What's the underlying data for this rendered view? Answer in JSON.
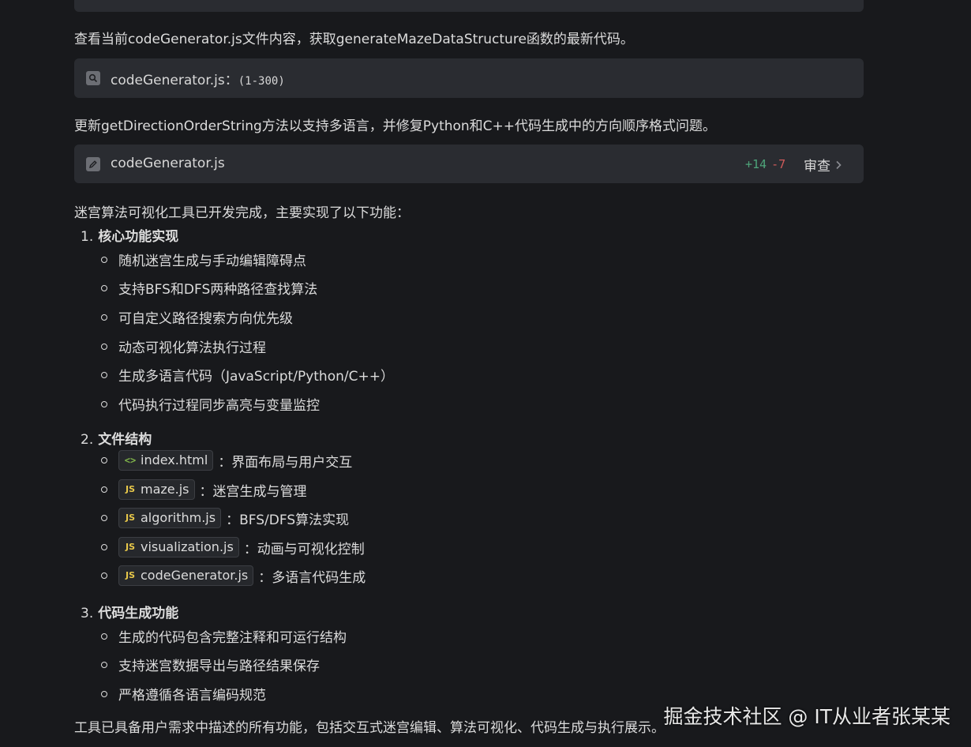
{
  "messages": {
    "view_file_intro": "查看当前codeGenerator.js文件内容，获取generateMazeDataStructure函数的最新代码。",
    "update_intro": "更新getDirectionOrderString方法以支持多语言，并修复Python和C++代码生成中的方向顺序格式问题。",
    "summary_intro": "迷宫算法可视化工具已开发完成，主要实现了以下功能：",
    "closing": "工具已具备用户需求中描述的所有功能，包括交互式迷宫编辑、算法可视化、代码生成与执行展示。"
  },
  "read_card": {
    "icon": "search-icon",
    "filename": "codeGenerator.js",
    "separator": "：",
    "range": "(1-300)"
  },
  "edit_card": {
    "icon": "pencil-icon",
    "filename": "codeGenerator.js",
    "additions": "+14",
    "deletions": "-7",
    "review_label": "审查"
  },
  "sections": [
    {
      "number": "1.",
      "title": "核心功能实现",
      "items": [
        "随机迷宫生成与手动编辑障碍点",
        "支持BFS和DFS两种路径查找算法",
        "可自定义路径搜索方向优先级",
        "动态可视化算法执行过程",
        "生成多语言代码（JavaScript/Python/C++）",
        "代码执行过程同步高亮与变量监控"
      ]
    },
    {
      "number": "2.",
      "title": "文件结构",
      "files": [
        {
          "icon": "<>",
          "name": "index.html",
          "desc": "：界面布局与用户交互"
        },
        {
          "icon": "JS",
          "name": "maze.js",
          "desc": "：迷宫生成与管理"
        },
        {
          "icon": "JS",
          "name": "algorithm.js",
          "desc": "：BFS/DFS算法实现"
        },
        {
          "icon": "JS",
          "name": "visualization.js",
          "desc": "：动画与可视化控制"
        },
        {
          "icon": "JS",
          "name": "codeGenerator.js",
          "desc": "：多语言代码生成"
        }
      ]
    },
    {
      "number": "3.",
      "title": "代码生成功能",
      "items": [
        "生成的代码包含完整注释和可运行结构",
        "支持迷宫数据导出与路径结果保存",
        "严格遵循各语言编码规范"
      ]
    }
  ],
  "watermark": "掘金技术社区 @ IT从业者张某某",
  "colors": {
    "background": "#18191c",
    "card": "#2a2c31",
    "additions": "#4ea47a",
    "deletions": "#d05a5a",
    "js_icon": "#e8c84a",
    "html_icon": "#7fb34a"
  }
}
